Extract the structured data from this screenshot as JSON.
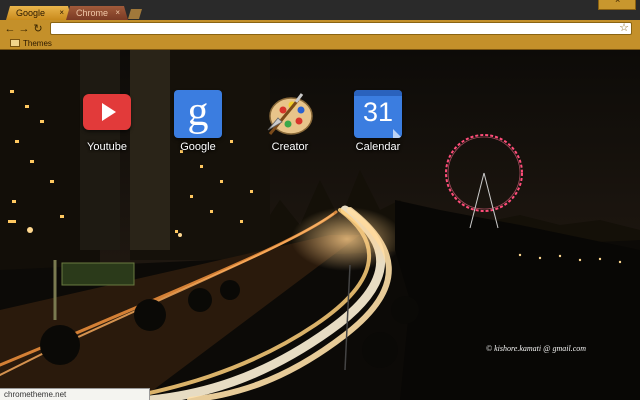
{
  "tabs": [
    {
      "label": "Google",
      "active": true
    },
    {
      "label": "Chrome",
      "active": false
    }
  ],
  "toolbar": {
    "omnibox_value": "",
    "icons": {
      "back": "back-arrow-icon",
      "forward": "forward-arrow-icon",
      "reload": "reload-icon",
      "bookmark": "star-icon"
    }
  },
  "bookmarks_bar": {
    "items": [
      {
        "label": "Themes",
        "icon": "folder-icon"
      }
    ]
  },
  "apps": [
    {
      "label": "Youtube",
      "icon": "youtube-icon"
    },
    {
      "label": "Google",
      "icon": "google-icon",
      "glyph": "g"
    },
    {
      "label": "Creator",
      "icon": "paint-palette-icon"
    },
    {
      "label": "Calendar",
      "icon": "calendar-icon",
      "glyph": "31"
    }
  ],
  "credit": "©  kishore.kamati @ gmail.com",
  "status_bar": "chrometheme.net",
  "colors": {
    "frame": "#c4902a",
    "active_tab": "#e0aa3e",
    "inactive_tab": "#8e4a30"
  }
}
